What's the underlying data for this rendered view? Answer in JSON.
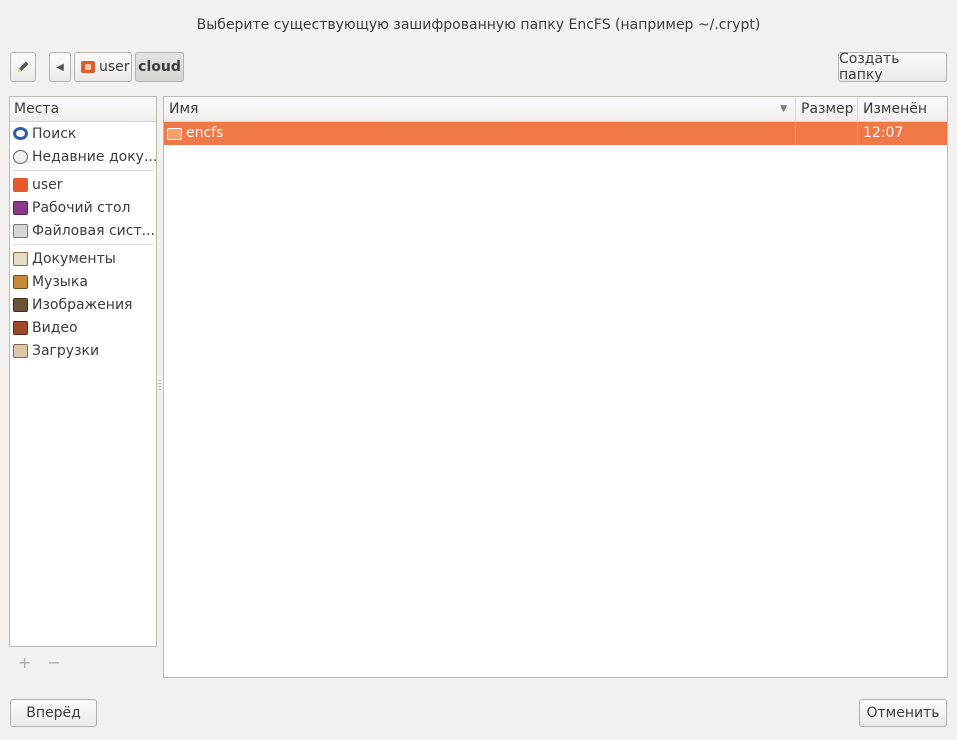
{
  "dialog": {
    "title": "Выберите существующую зашифрованную папку EncFS (например ~/.crypt)"
  },
  "toolbar": {
    "breadcrumbs": [
      "user",
      "cloud"
    ],
    "create_folder_label": "Создать папку"
  },
  "sidebar": {
    "header": "Места",
    "items": [
      {
        "label": "Поиск",
        "icon": "search-icon"
      },
      {
        "label": "Недавние доку...",
        "icon": "recent-icon"
      },
      {
        "label": "user",
        "icon": "home-folder-icon"
      },
      {
        "label": "Рабочий стол",
        "icon": "desktop-icon"
      },
      {
        "label": "Файловая сист...",
        "icon": "drive-icon"
      },
      {
        "label": "Документы",
        "icon": "documents-folder-icon"
      },
      {
        "label": "Музыка",
        "icon": "music-folder-icon"
      },
      {
        "label": "Изображения",
        "icon": "pictures-folder-icon"
      },
      {
        "label": "Видео",
        "icon": "videos-folder-icon"
      },
      {
        "label": "Загрузки",
        "icon": "downloads-folder-icon"
      }
    ],
    "add_label": "+",
    "remove_label": "−"
  },
  "filelist": {
    "columns": [
      "Имя",
      "Размер",
      "Изменён"
    ],
    "rows": [
      {
        "name": "encfs",
        "size": "",
        "modified": "12:07",
        "selected": true,
        "icon": "folder-icon"
      }
    ]
  },
  "footer": {
    "forward_label": "Вперёд",
    "cancel_label": "Отменить"
  },
  "colors": {
    "selection": "#f07746",
    "window_bg": "#f2f1f0"
  }
}
